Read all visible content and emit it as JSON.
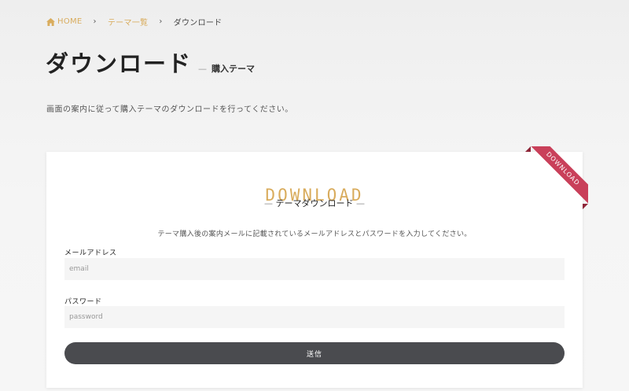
{
  "breadcrumb": {
    "home": "HOME",
    "parent": "テーマ一覧",
    "current": "ダウンロード",
    "separator": "›"
  },
  "header": {
    "title": "ダウンロード",
    "subtitle_dash": "—",
    "subtitle": "購入テーマ",
    "intro": "画面の案内に従って購入テーマのダウンロードを行ってください。"
  },
  "card": {
    "ribbon": "DOWNLOAD",
    "heading": "DOWNLOAD",
    "subheading": "テーマダウンロード",
    "subheading_line": "—",
    "description": "テーマ購入後の案内メールに記載されているメールアドレスとパスワードを入力してください。",
    "email_label": "メールアドレス",
    "email_placeholder": "email",
    "email_value": "",
    "password_label": "パスワード",
    "password_placeholder": "password",
    "password_value": "",
    "submit_label": "送信"
  },
  "colors": {
    "accent": "#d9ac5d",
    "ribbon": "#c9405a",
    "button": "#4a4b4f"
  }
}
